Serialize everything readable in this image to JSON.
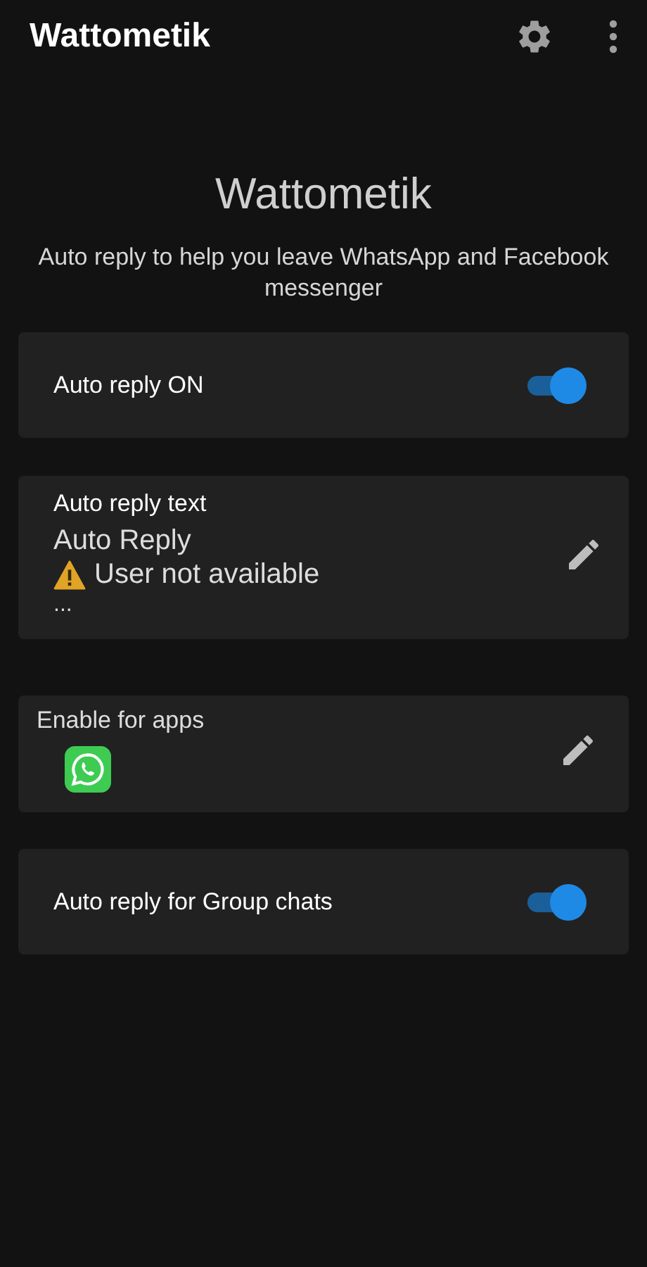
{
  "app_bar": {
    "title": "Wattometik"
  },
  "hero": {
    "title": "Wattometik",
    "subtitle": "Auto reply to help you leave WhatsApp and Facebook messenger"
  },
  "cards": [
    {
      "kind": "toggle",
      "label": "Auto reply ON",
      "on": true
    },
    {
      "kind": "text",
      "label": "Auto reply text",
      "lines": [
        {
          "kind": "plain",
          "text": "Auto Reply"
        },
        {
          "kind": "warning",
          "text": "User not available"
        },
        {
          "kind": "more",
          "text": "..."
        }
      ]
    },
    {
      "kind": "apps",
      "label": "Enable for apps"
    },
    {
      "kind": "toggle",
      "label": "Auto reply for Group chats",
      "on": true
    }
  ]
}
